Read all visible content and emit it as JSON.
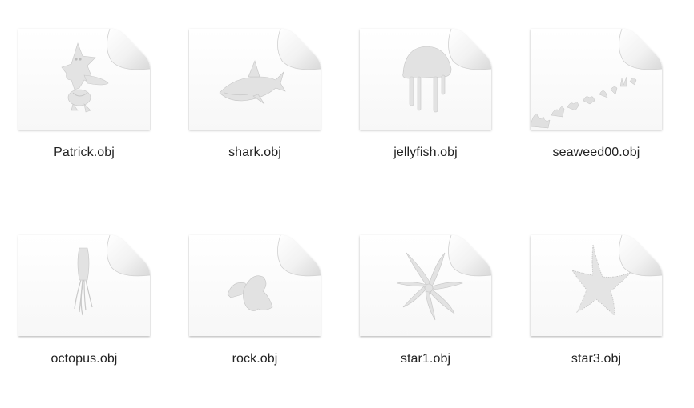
{
  "window": {
    "view": "icon-grid"
  },
  "files": [
    {
      "name": "Patrick.obj",
      "thumbnail": "patrick-starfish-model-icon"
    },
    {
      "name": "shark.obj",
      "thumbnail": "shark-model-icon"
    },
    {
      "name": "jellyfish.obj",
      "thumbnail": "jellyfish-model-icon"
    },
    {
      "name": "seaweed00.obj",
      "thumbnail": "seaweed-model-icon"
    },
    {
      "name": "octopus.obj",
      "thumbnail": "octopus-model-icon"
    },
    {
      "name": "rock.obj",
      "thumbnail": "rock-model-icon"
    },
    {
      "name": "star1.obj",
      "thumbnail": "star-spiky-model-icon"
    },
    {
      "name": "star3.obj",
      "thumbnail": "starfish-model-icon"
    }
  ],
  "colors": {
    "background": "#ffffff",
    "label": "#222222",
    "page": "#ffffff",
    "page_shadow": "#bdbdbd",
    "model_fill": "#e6e6e6",
    "model_shade": "#c4c4c4"
  }
}
